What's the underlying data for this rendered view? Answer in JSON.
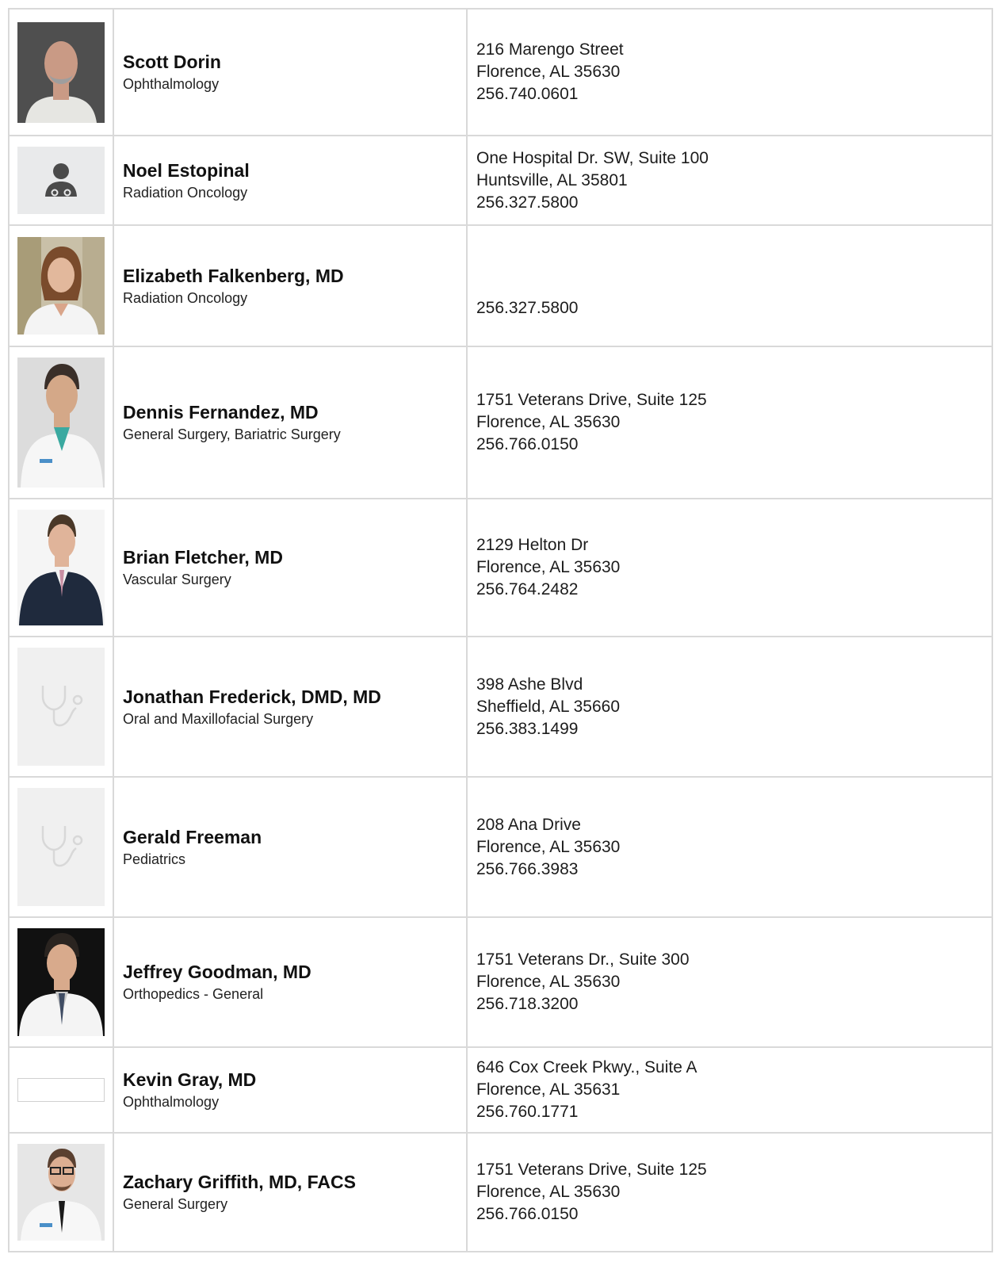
{
  "providers": [
    {
      "name": "Scott Dorin",
      "specialty": "Ophthalmology",
      "address1": "216 Marengo Street",
      "address2": "Florence, AL 35630",
      "phone": "256.740.0601",
      "photo": "headshot-man-bald-gray-goatee"
    },
    {
      "name": "Noel Estopinal",
      "specialty": "Radiation Oncology",
      "address1": "One Hospital Dr. SW, Suite 100",
      "address2": "Huntsville, AL 35801",
      "phone": "256.327.5800",
      "photo": "doctor-placeholder-icon"
    },
    {
      "name": "Elizabeth Falkenberg, MD",
      "specialty": "Radiation Oncology",
      "address1": "",
      "address2": "",
      "phone": "256.327.5800",
      "photo": "headshot-woman-white-coat"
    },
    {
      "name": "Dennis Fernandez, MD",
      "specialty": "General Surgery, Bariatric Surgery",
      "address1": "1751 Veterans Drive, Suite 125",
      "address2": "Florence, AL 35630",
      "phone": "256.766.0150",
      "photo": "headshot-man-white-coat"
    },
    {
      "name": "Brian Fletcher, MD",
      "specialty": "Vascular Surgery",
      "address1": "2129 Helton Dr",
      "address2": "Florence, AL 35630",
      "phone": "256.764.2482",
      "photo": "headshot-man-suit"
    },
    {
      "name": "Jonathan Frederick, DMD, MD",
      "specialty": "Oral and Maxillofacial Surgery",
      "address1": "398 Ashe Blvd",
      "address2": "Sheffield, AL 35660",
      "phone": "256.383.1499",
      "photo": "stethoscope-placeholder-icon"
    },
    {
      "name": "Gerald Freeman",
      "specialty": "Pediatrics",
      "address1": "208 Ana Drive",
      "address2": "Florence, AL 35630",
      "phone": "256.766.3983",
      "photo": "stethoscope-placeholder-icon"
    },
    {
      "name": "Jeffrey Goodman, MD",
      "specialty": "Orthopedics - General",
      "address1": "1751 Veterans Dr., Suite 300",
      "address2": "Florence, AL 35630",
      "phone": "256.718.3200",
      "photo": "headshot-man-white-coat-dark-bg"
    },
    {
      "name": "Kevin Gray, MD",
      "specialty": "Ophthalmology",
      "address1": "646 Cox Creek Pkwy., Suite A",
      "address2": "Florence, AL 35631",
      "phone": "256.760.1771",
      "photo": "blank-photo"
    },
    {
      "name": "Zachary Griffith, MD, FACS",
      "specialty": "General Surgery",
      "address1": "1751 Veterans Drive, Suite 125",
      "address2": "Florence, AL 35630",
      "phone": "256.766.0150",
      "photo": "headshot-man-glasses-white-coat"
    }
  ],
  "colors": {
    "border": "#d9d9d9",
    "placeholder_bg": "#f0f0f0",
    "icon_gray": "#4a4a4a"
  }
}
